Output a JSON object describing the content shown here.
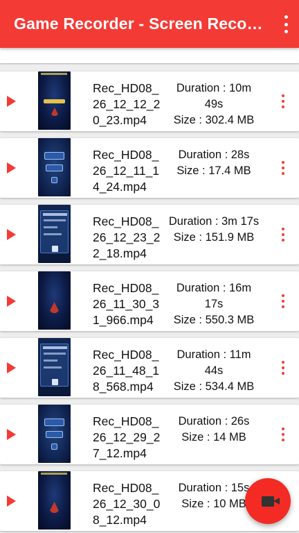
{
  "app_bar": {
    "title": "Game Recorder - Screen Recorder",
    "menu_icon": "more-vert-icon"
  },
  "colors": {
    "accent": "#f43a35",
    "fab": "#f42a24",
    "text": "#111111",
    "background": "#eeeeee"
  },
  "recordings": [
    {
      "name": "Rec_HD08_26_12_12_20_23.mp4",
      "duration": "Duration : 10m 49s",
      "size": "Size : 302.4 MB",
      "thumb": "space-game-over"
    },
    {
      "name": "Rec_HD08_26_12_11_14_24.mp4",
      "duration": "Duration : 28s",
      "size": "Size : 17.4 MB",
      "thumb": "start-menu"
    },
    {
      "name": "Rec_HD08_26_12_23_22_18.mp4",
      "duration": "Duration : 3m 17s",
      "size": "Size : 151.9 MB",
      "thumb": "settings-panel"
    },
    {
      "name": "Rec_HD08_26_11_30_31_966.mp4",
      "duration": "Duration : 16m 17s",
      "size": "Size : 550.3 MB",
      "thumb": "space-gameplay"
    },
    {
      "name": "Rec_HD08_26_11_48_18_568.mp4",
      "duration": "Duration : 11m 44s",
      "size": "Size : 534.4 MB",
      "thumb": "settings-panel"
    },
    {
      "name": "Rec_HD08_26_12_29_27_12.mp4",
      "duration": "Duration : 26s",
      "size": "Size : 14 MB",
      "thumb": "start-menu"
    },
    {
      "name": "Rec_HD08_26_12_30_08_12.mp4",
      "duration": "Duration : 15s",
      "size": "Size : 10 MB",
      "thumb": "space-gameplay"
    }
  ],
  "fab": {
    "icon": "videocam-icon"
  }
}
